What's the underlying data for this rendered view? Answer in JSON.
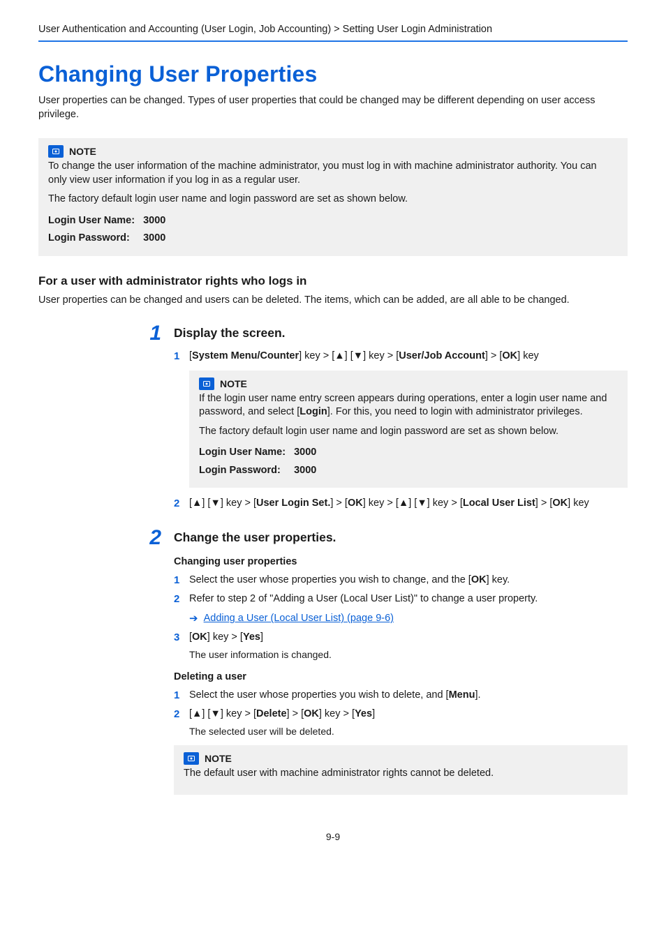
{
  "breadcrumb": "User Authentication and Accounting (User Login, Job Accounting) > Setting User Login Administration",
  "title": "Changing User Properties",
  "intro": "User properties can be changed. Types of user properties that could be changed may be different depending on user access privilege.",
  "note1": {
    "label": "NOTE",
    "body1": "To change the user information of the machine administrator, you must log in with machine administrator authority. You can only view user information if you log in as a regular user.",
    "body2": "The factory default login user name and login password are set as shown below.",
    "user_label": "Login User Name:",
    "user_value": "3000",
    "pass_label": "Login Password:",
    "pass_value": "3000"
  },
  "subheading": "For a user with administrator rights who logs in",
  "sub_desc": "User properties can be changed and users can be deleted. The items, which can be added, are all able to be changed.",
  "step1": {
    "num": "1",
    "title": "Display the screen.",
    "sub1_num": "1",
    "sub1_prefix": "[",
    "sub1_b1": "System Menu/Counter",
    "sub1_mid1": "] key > [▲] [▼] key > [",
    "sub1_b2": "User/Job Account",
    "sub1_mid2": "] > [",
    "sub1_b3": "OK",
    "sub1_suffix": "] key",
    "note": {
      "label": "NOTE",
      "body1a": "If the login user name entry screen appears during operations, enter a login user name and password, and select [",
      "body1b": "Login",
      "body1c": "]. For this, you need to login with administrator privileges.",
      "body2": "The factory default login user name and login password are set as shown below.",
      "user_label": "Login User Name:",
      "user_value": "3000",
      "pass_label": "Login Password:",
      "pass_value": "3000"
    },
    "sub2_num": "2",
    "sub2_t1": "[▲] [▼] key > [",
    "sub2_b1": "User Login Set.",
    "sub2_t2": "] > [",
    "sub2_b2": "OK",
    "sub2_t3": "] key > [▲] [▼] key > [",
    "sub2_b3": "Local User List",
    "sub2_t4": "] > [",
    "sub2_b4": "OK",
    "sub2_t5": "] key"
  },
  "step2": {
    "num": "2",
    "title": "Change the user properties.",
    "group1_title": "Changing user properties",
    "g1_s1_num": "1",
    "g1_s1_a": "Select the user whose properties you wish to change, and the [",
    "g1_s1_b": "OK",
    "g1_s1_c": "] key.",
    "g1_s2_num": "2",
    "g1_s2_text": "Refer to step 2 of \"Adding a User (Local User List)\" to change a user property.",
    "g1_link": "Adding a User (Local User List) (page 9-6)",
    "g1_s3_num": "3",
    "g1_s3_a": "[",
    "g1_s3_b1": "OK",
    "g1_s3_c": "] key > [",
    "g1_s3_b2": "Yes",
    "g1_s3_d": "]",
    "g1_result": "The user information is changed.",
    "group2_title": "Deleting a user",
    "g2_s1_num": "1",
    "g2_s1_a": "Select the user whose properties you wish to delete, and [",
    "g2_s1_b": "Menu",
    "g2_s1_c": "].",
    "g2_s2_num": "2",
    "g2_s2_a": "[▲] [▼] key > [",
    "g2_s2_b1": "Delete",
    "g2_s2_c": "] > [",
    "g2_s2_b2": "OK",
    "g2_s2_d": "] key > [",
    "g2_s2_b3": "Yes",
    "g2_s2_e": "]",
    "g2_result": "The selected user will be deleted.",
    "note2_label": "NOTE",
    "note2_body": "The default user with machine administrator rights cannot be deleted."
  },
  "page_number": "9-9"
}
